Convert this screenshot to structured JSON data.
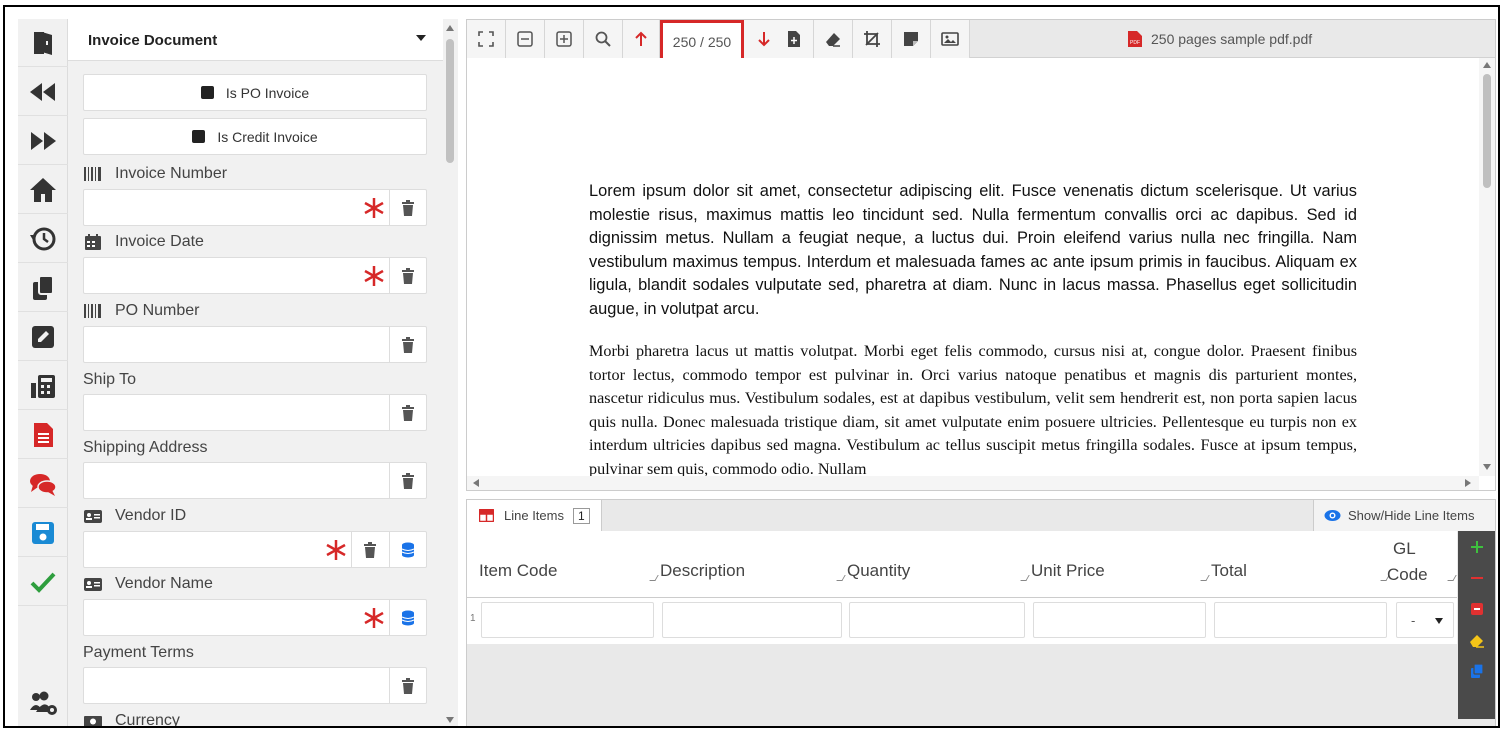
{
  "form": {
    "document_type": "Invoice Document",
    "checks": [
      {
        "label": "Is PO Invoice"
      },
      {
        "label": "Is Credit Invoice"
      }
    ],
    "fields": {
      "invoice_number": {
        "label": "Invoice Number",
        "value": ""
      },
      "invoice_date": {
        "label": "Invoice Date",
        "value": ""
      },
      "po_number": {
        "label": "PO Number",
        "value": ""
      },
      "ship_to": {
        "label": "Ship To",
        "value": ""
      },
      "shipping_address": {
        "label": "Shipping Address",
        "value": ""
      },
      "vendor_id": {
        "label": "Vendor ID",
        "value": ""
      },
      "vendor_name": {
        "label": "Vendor Name",
        "value": ""
      },
      "payment_terms": {
        "label": "Payment Terms",
        "value": ""
      },
      "currency": {
        "label": "Currency"
      }
    }
  },
  "viewer": {
    "page_indicator": "250 / 250",
    "file_name": "250 pages sample pdf.pdf",
    "paragraph_1": "Lorem ipsum dolor sit amet, consectetur adipiscing elit. Fusce venenatis dictum scelerisque. Ut varius molestie risus, maximus mattis leo tincidunt sed. Nulla fermentum convallis orci ac dapibus. Sed id dignissim metus. Nullam a feugiat neque, a luctus dui. Proin eleifend varius nulla nec fringilla. Nam vestibulum maximus tempus. Interdum et malesuada fames ac ante ipsum primis in faucibus. Aliquam ex ligula, blandit sodales vulputate sed, pharetra at diam. Nunc in lacus massa. Phasellus eget sollicitudin augue, in volutpat arcu.",
    "paragraph_2": "Morbi pharetra lacus ut mattis volutpat. Morbi eget felis commodo, cursus nisi at, congue dolor. Praesent finibus tortor lectus, commodo tempor est pulvinar in. Orci varius natoque penatibus et magnis dis parturient montes, nascetur ridiculus mus. Vestibulum sodales, est at dapibus vestibulum, velit sem hendrerit est, non porta sapien lacus quis nulla. Donec malesuada tristique diam, sit amet vulputate enim posuere ultricies. Pellentesque eu turpis non ex interdum ultricies dapibus sed magna. Vestibulum ac tellus suscipit metus fringilla sodales. Fusce at ipsum tempus, pulvinar sem quis, commodo odio. Nullam"
  },
  "line_items": {
    "tab_label": "Line Items",
    "count": "1",
    "toggle_label": "Show/Hide Line Items",
    "columns": [
      "Item Code",
      "Description",
      "Quantity",
      "Unit Price",
      "Total",
      "GL",
      "Code"
    ],
    "rows": [
      {
        "num": "1",
        "gl_code": "-"
      }
    ]
  },
  "colors": {
    "required": "#d62828",
    "accent_blue": "#1a73e8",
    "highlight_border": "#d62828"
  }
}
